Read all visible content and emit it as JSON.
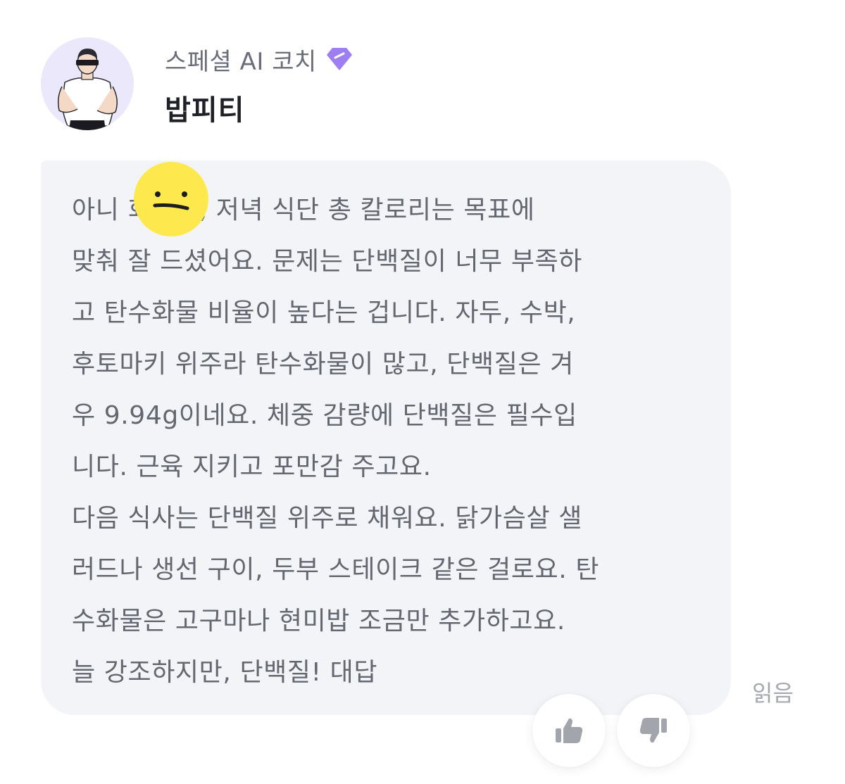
{
  "header": {
    "coach_type": "스페셜 AI 코치",
    "coach_name": "밥피티"
  },
  "message": {
    "lines": [
      "아니         회원님, 저녁 식단 총 칼로리는 목표에",
      "맞춰 잘 드셨어요. 문제는 단백질이 너무 부족하",
      "고 탄수화물 비율이 높다는 겁니다. 자두, 수박,",
      "후토마키 위주라 탄수화물이 많고, 단백질은 겨",
      "우 9.94g이네요. 체중 감량에 단백질은 필수입",
      "니다. 근육 지키고 포만감 주고요.",
      "다음 식사는 단백질 위주로 채워요. 닭가슴살 샐",
      "러드나 생선 구이, 두부 스테이크 같은 걸로요. 탄",
      "수화물은 고구마나 현미밥 조금만 추가하고요.",
      "늘 강조하지만, 단백질! 대답"
    ],
    "read_status": "읽음"
  },
  "icons": {
    "avatar": "coach-avatar",
    "badge": "diamond-badge-icon",
    "emoji": "neutral-face-emoji",
    "like": "thumbs-up-icon",
    "dislike": "thumbs-down-icon"
  },
  "colors": {
    "badge": "#9d7ff2",
    "bubble": "#f3f4f8",
    "emoji": "#fde94d",
    "text": "#64676f",
    "icon": "#a3a5ad"
  }
}
